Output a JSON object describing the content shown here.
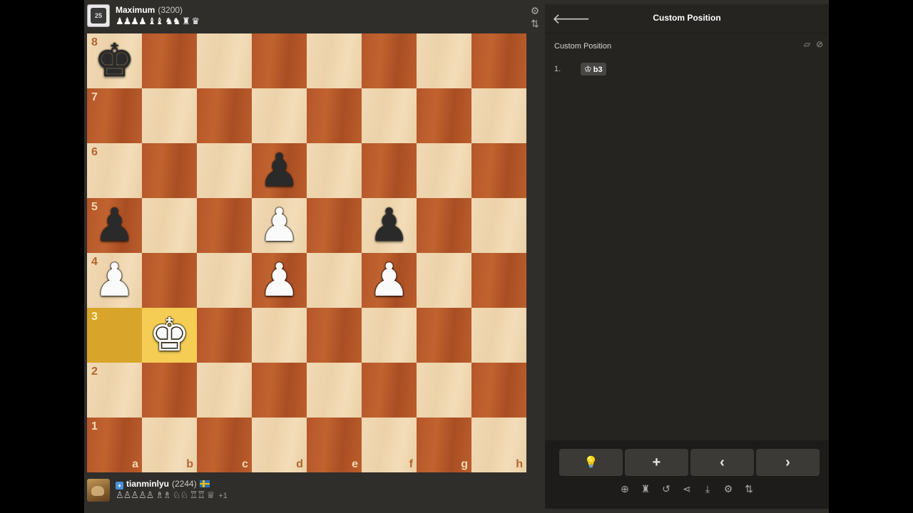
{
  "top_player": {
    "name": "Maximum",
    "rating": "(3200)",
    "avatar_text": "25",
    "captured": "♟♟♟♟ ♝♝ ♞♞ ♜ ♛"
  },
  "bottom_player": {
    "name": "tianminlyu",
    "rating": "(2244)",
    "captured": "♙♙♙♙♙ ♗♗ ♘♘ ♖♖ ♕",
    "advantage": "+1"
  },
  "board_icons": {
    "settings": "⚙",
    "flip": "⇅"
  },
  "board": {
    "files": [
      "a",
      "b",
      "c",
      "d",
      "e",
      "f",
      "g",
      "h"
    ],
    "ranks": [
      "8",
      "7",
      "6",
      "5",
      "4",
      "3",
      "2",
      "1"
    ],
    "highlights": [
      "a3",
      "b3"
    ],
    "pieces": [
      {
        "square": "a8",
        "glyph": "♚",
        "color": "black",
        "name": "black-king"
      },
      {
        "square": "d6",
        "glyph": "♟",
        "color": "black",
        "name": "black-pawn"
      },
      {
        "square": "a5",
        "glyph": "♟",
        "color": "black",
        "name": "black-pawn"
      },
      {
        "square": "d5",
        "glyph": "♟",
        "color": "white",
        "name": "white-pawn"
      },
      {
        "square": "f5",
        "glyph": "♟",
        "color": "black",
        "name": "black-pawn"
      },
      {
        "square": "a4",
        "glyph": "♟",
        "color": "white",
        "name": "white-pawn"
      },
      {
        "square": "d4",
        "glyph": "♟",
        "color": "white",
        "name": "white-pawn"
      },
      {
        "square": "f4",
        "glyph": "♟",
        "color": "white",
        "name": "white-pawn"
      },
      {
        "square": "b3",
        "glyph": "♚",
        "color": "white",
        "name": "white-king"
      }
    ]
  },
  "panel": {
    "back_icon": "🡐",
    "title": "Custom Position",
    "subtitle": "Custom Position",
    "sub_icons": [
      "▱",
      "⊘"
    ],
    "moves": [
      {
        "number": "1.",
        "piece": "♔",
        "san": "b3"
      }
    ],
    "controls": [
      {
        "name": "hint-button",
        "icon": "💡"
      },
      {
        "name": "add-button",
        "icon": "+"
      },
      {
        "name": "previous-move-button",
        "icon": "‹"
      },
      {
        "name": "next-move-button",
        "icon": "›"
      }
    ],
    "tools": [
      {
        "name": "analysis-zoom-icon",
        "icon": "⊕"
      },
      {
        "name": "explorer-icon",
        "icon": "♜"
      },
      {
        "name": "reset-icon",
        "icon": "↺"
      },
      {
        "name": "share-icon",
        "icon": "⋖"
      },
      {
        "name": "download-icon",
        "icon": "⤓"
      },
      {
        "name": "settings-icon",
        "icon": "⚙"
      },
      {
        "name": "flip-board-icon",
        "icon": "⇅"
      }
    ]
  }
}
